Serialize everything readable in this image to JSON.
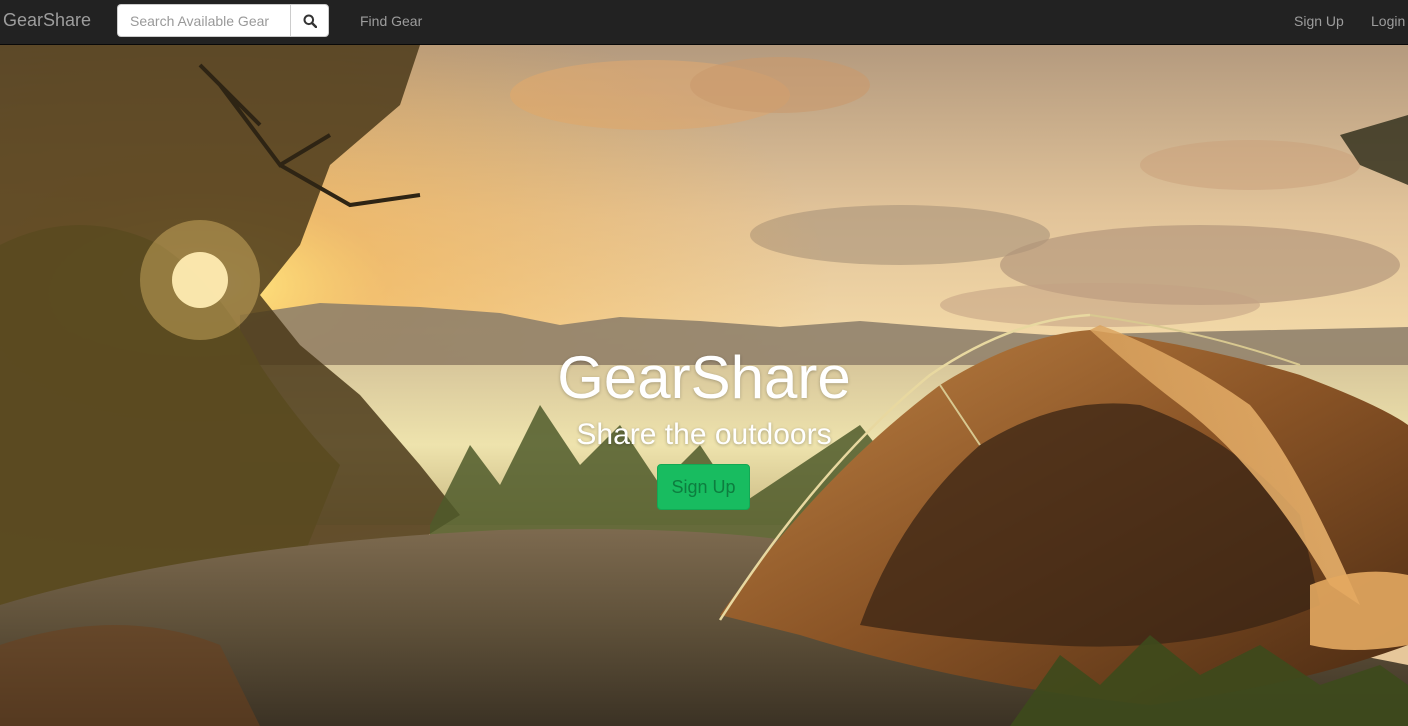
{
  "navbar": {
    "brand": "GearShare",
    "search_placeholder": "Search Available Gear",
    "search_icon": "search-icon",
    "find_gear": "Find Gear",
    "sign_up": "Sign Up",
    "login": "Login"
  },
  "hero": {
    "title": "GearShare",
    "subtitle": "Share the outdoors",
    "cta_label": "Sign Up",
    "image": "sunset camping scene with tent on rock overlooking lake and mountains"
  },
  "colors": {
    "navbar_bg": "#222222",
    "nav_text": "#9d9d9d",
    "cta_green": "#18bc60"
  }
}
